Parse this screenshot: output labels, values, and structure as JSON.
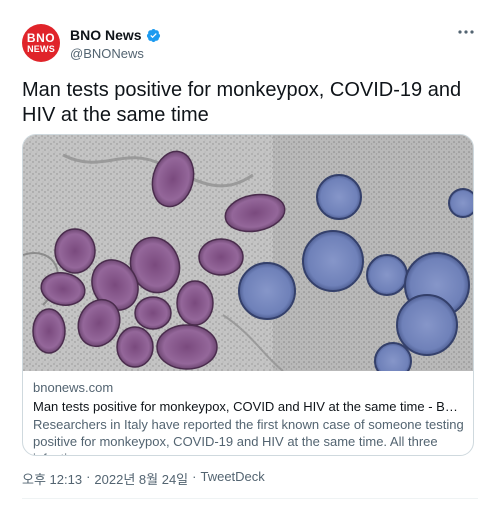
{
  "account": {
    "avatar_line1": "BNO",
    "avatar_line2": "NEWS",
    "display_name": "BNO News",
    "handle": "@BNONews",
    "verified": true
  },
  "tweet": {
    "text": "Man tests positive for monkeypox, COVID-19 and HIV at the same time"
  },
  "card": {
    "domain": "bnonews.com",
    "title": "Man tests positive for monkeypox, COVID and HIV at the same time - BNO News",
    "description": "Researchers in Italy have reported the first known case of someone testing positive for monkeypox, COVID-19 and HIV at the same time. All three infection..."
  },
  "meta": {
    "time": "오후 12:13",
    "separator1": "·",
    "date": "2022년 8월 24일",
    "separator2": "·",
    "source": "TweetDeck"
  },
  "colors": {
    "verified_badge": "#1d9bf0",
    "avatar_bg": "#e0242a",
    "monkeypox_particles": "#8e5d8f",
    "covid_particles": "#6b7fb5"
  }
}
